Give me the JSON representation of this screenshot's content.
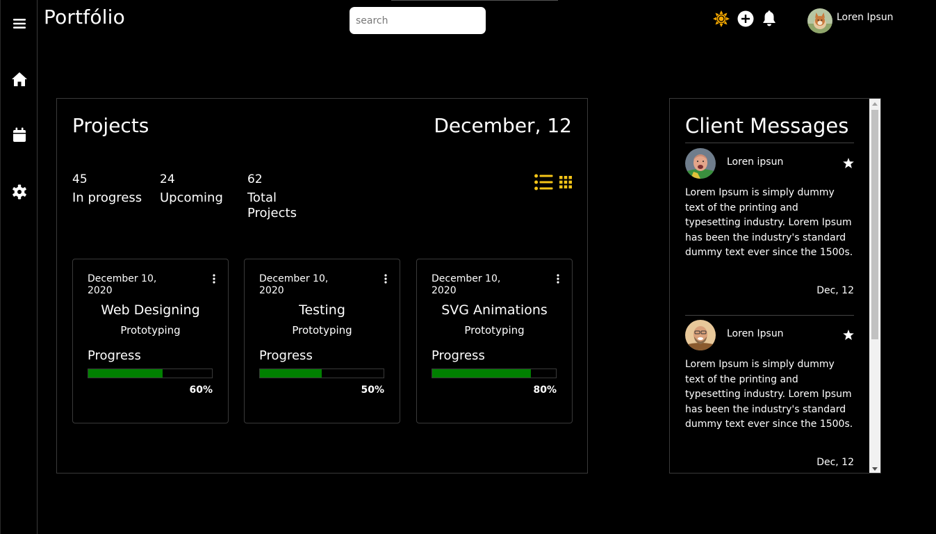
{
  "app": {
    "title": "Portfólio"
  },
  "search": {
    "placeholder": "search"
  },
  "user": {
    "name": "Loren Ipsun"
  },
  "colors": {
    "accent": "#f5c518",
    "sun": "#f5a800",
    "progress": "#008000",
    "background": "#000000"
  },
  "icons": {
    "sidebar": [
      "menu-icon",
      "home-icon",
      "calendar-icon",
      "gear-icon"
    ],
    "topbar": [
      "sun-icon",
      "add-circle-icon",
      "bell-icon"
    ]
  },
  "projects": {
    "title": "Projects",
    "date": "December, 12",
    "stats": [
      {
        "value": "45",
        "label": "In progress"
      },
      {
        "value": "24",
        "label": "Upcoming"
      },
      {
        "value": "62",
        "label": "Total Projects"
      }
    ],
    "cards": [
      {
        "date": "December 10, 2020",
        "title": "Web Designing",
        "subtitle": "Prototyping",
        "progress_label": "Progress",
        "progress_pct": 60,
        "progress_text": "60%"
      },
      {
        "date": "December 10, 2020",
        "title": "Testing",
        "subtitle": "Prototyping",
        "progress_label": "Progress",
        "progress_pct": 50,
        "progress_text": "50%"
      },
      {
        "date": "December 10, 2020",
        "title": "SVG Animations",
        "subtitle": "Prototyping",
        "progress_label": "Progress",
        "progress_pct": 80,
        "progress_text": "80%"
      }
    ]
  },
  "messages": {
    "title": "Client Messages",
    "items": [
      {
        "name": "Loren ipsun",
        "text": "Lorem Ipsum is simply dummy text of the printing and typesetting industry. Lorem Ipsum has been the industry's standard dummy text ever since the 1500s.",
        "date": "Dec, 12"
      },
      {
        "name": "Loren Ipsun",
        "text": "Lorem Ipsum is simply dummy text of the printing and typesetting industry. Lorem Ipsum has been the industry's standard dummy text ever since the 1500s.",
        "date": "Dec, 12"
      }
    ]
  }
}
